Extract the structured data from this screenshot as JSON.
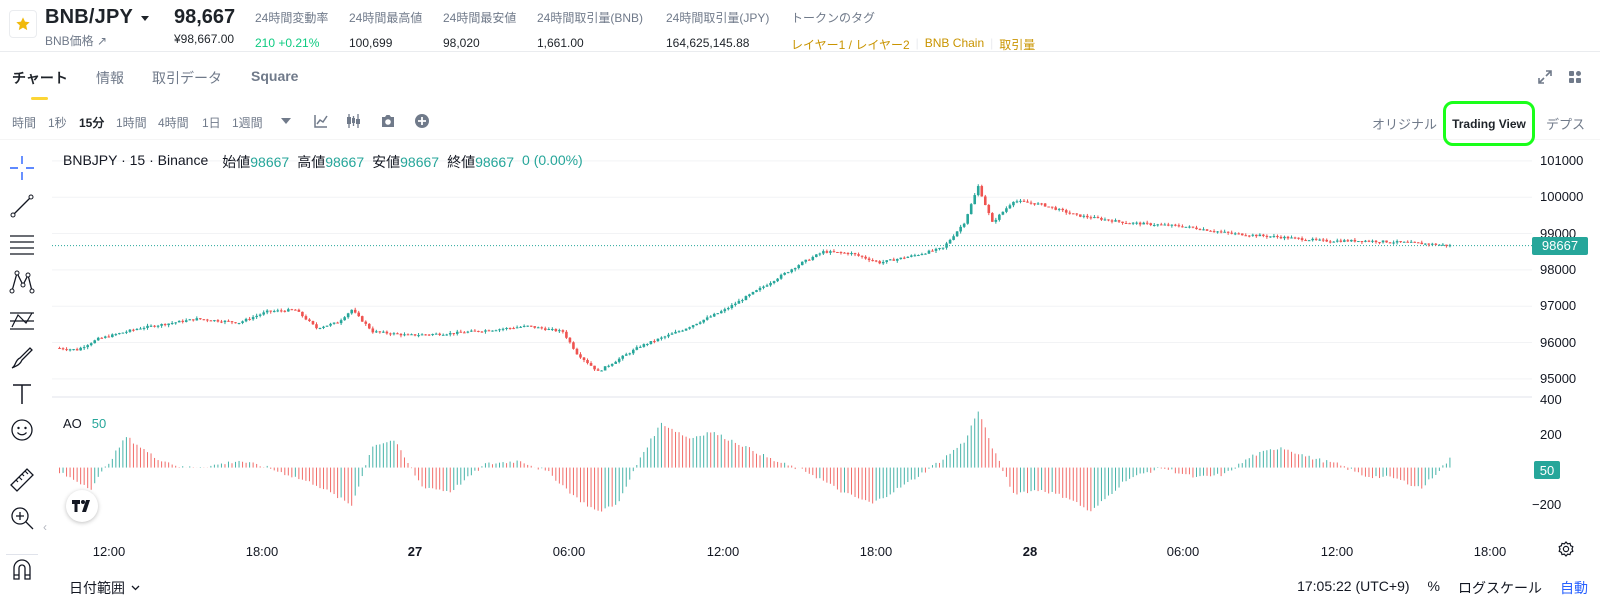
{
  "ticker": {
    "symbol": "BNB/JPY",
    "sub_label": "BNB価格 ↗",
    "last_price": "98,667",
    "last_price_fiat": "¥98,667.00",
    "stats": [
      {
        "label": "24時間変動率",
        "value": "210 +0.21%"
      },
      {
        "label": "24時間最高値",
        "value": "100,699"
      },
      {
        "label": "24時間最安値",
        "value": "98,020"
      },
      {
        "label": "24時間取引量(BNB)",
        "value": "1,661.00"
      },
      {
        "label": "24時間取引量(JPY)",
        "value": "164,625,145.88"
      }
    ],
    "token_tags_label": "トークンのタグ",
    "token_tags": [
      "レイヤー1 / レイヤー2",
      "BNB Chain",
      "取引量"
    ],
    "colors": {
      "up": "#0ecb81",
      "down": "#f6465d",
      "accent": "#fcd535",
      "tag": "#c99400"
    }
  },
  "tabs": [
    "チャート",
    "情報",
    "取引データ",
    "Square"
  ],
  "intervals": [
    "時間",
    "1秒",
    "15分",
    "1時間",
    "4時間",
    "1日",
    "1週間"
  ],
  "active_interval": "15分",
  "view_options": {
    "original": "オリジナル",
    "tradingview": "Trading View",
    "depth": "デプス"
  },
  "legend": {
    "symbol": "BNBJPY · 15 · Binance",
    "open_label": "始値",
    "open": "98667",
    "high_label": "高値",
    "high": "98667",
    "low_label": "安値",
    "low": "98667",
    "close_label": "終値",
    "close": "98667",
    "change": "0 (0.00%)"
  },
  "ao": {
    "name": "AO",
    "value": "50"
  },
  "price_axis": {
    "labels": [
      "101000",
      "100000",
      "99000",
      "98000",
      "97000",
      "96000",
      "95000"
    ],
    "current": "98667"
  },
  "ao_axis": {
    "labels": [
      "400",
      "200",
      "0",
      "−200"
    ],
    "current": "50"
  },
  "time_axis": [
    "12:00",
    "18:00",
    "27",
    "06:00",
    "12:00",
    "18:00",
    "28",
    "06:00",
    "12:00",
    "18:00"
  ],
  "bottom_bar": {
    "date_range": "日付範囲",
    "clock": "17:05:22 (UTC+9)",
    "percent": "%",
    "log_scale": "ログスケール",
    "auto": "自動"
  },
  "chart_data": {
    "type": "candlestick",
    "title": "BNBJPY · 15 · Binance",
    "x_ticks": [
      "12:00",
      "18:00",
      "27",
      "06:00",
      "12:00",
      "18:00",
      "28",
      "06:00",
      "12:00",
      "18:00"
    ],
    "ylim": [
      94500,
      101300
    ],
    "y_ticks": [
      95000,
      96000,
      97000,
      98000,
      99000,
      100000,
      101000
    ],
    "anchors": [
      [
        0,
        95850
      ],
      [
        6,
        95800
      ],
      [
        12,
        96100
      ],
      [
        24,
        96400
      ],
      [
        40,
        96650
      ],
      [
        52,
        96550
      ],
      [
        60,
        96850
      ],
      [
        68,
        96900
      ],
      [
        74,
        96400
      ],
      [
        80,
        96550
      ],
      [
        84,
        96900
      ],
      [
        90,
        96300
      ],
      [
        100,
        96200
      ],
      [
        112,
        96250
      ],
      [
        124,
        96350
      ],
      [
        134,
        96450
      ],
      [
        144,
        96300
      ],
      [
        148,
        95700
      ],
      [
        154,
        95200
      ],
      [
        166,
        95900
      ],
      [
        178,
        96350
      ],
      [
        190,
        96900
      ],
      [
        202,
        97600
      ],
      [
        212,
        98200
      ],
      [
        218,
        98500
      ],
      [
        226,
        98450
      ],
      [
        234,
        98200
      ],
      [
        244,
        98400
      ],
      [
        252,
        98600
      ],
      [
        258,
        99300
      ],
      [
        262,
        100300
      ],
      [
        266,
        99300
      ],
      [
        272,
        99900
      ],
      [
        280,
        99800
      ],
      [
        290,
        99500
      ],
      [
        304,
        99300
      ],
      [
        320,
        99200
      ],
      [
        334,
        99000
      ],
      [
        348,
        98900
      ],
      [
        360,
        98800
      ],
      [
        372,
        98800
      ],
      [
        384,
        98750
      ],
      [
        392,
        98700
      ],
      [
        396,
        98667
      ]
    ],
    "ao_range": [
      -300,
      400
    ],
    "ao_anchors": [
      [
        0,
        -20
      ],
      [
        10,
        -120
      ],
      [
        20,
        180
      ],
      [
        28,
        60
      ],
      [
        36,
        0
      ],
      [
        44,
        10
      ],
      [
        52,
        40
      ],
      [
        60,
        0
      ],
      [
        74,
        -100
      ],
      [
        84,
        -220
      ],
      [
        90,
        130
      ],
      [
        96,
        160
      ],
      [
        104,
        -110
      ],
      [
        112,
        -140
      ],
      [
        122,
        20
      ],
      [
        132,
        40
      ],
      [
        140,
        -30
      ],
      [
        148,
        -180
      ],
      [
        154,
        -260
      ],
      [
        160,
        -200
      ],
      [
        166,
        60
      ],
      [
        172,
        260
      ],
      [
        180,
        170
      ],
      [
        186,
        210
      ],
      [
        194,
        140
      ],
      [
        204,
        40
      ],
      [
        214,
        -30
      ],
      [
        224,
        -150
      ],
      [
        232,
        -210
      ],
      [
        242,
        -90
      ],
      [
        252,
        50
      ],
      [
        258,
        150
      ],
      [
        262,
        330
      ],
      [
        266,
        120
      ],
      [
        272,
        -150
      ],
      [
        280,
        -130
      ],
      [
        288,
        -180
      ],
      [
        294,
        -260
      ],
      [
        304,
        -70
      ],
      [
        314,
        0
      ],
      [
        324,
        -60
      ],
      [
        332,
        -40
      ],
      [
        340,
        70
      ],
      [
        348,
        120
      ],
      [
        356,
        60
      ],
      [
        364,
        20
      ],
      [
        372,
        -50
      ],
      [
        380,
        -60
      ],
      [
        388,
        -120
      ],
      [
        396,
        50
      ]
    ]
  }
}
